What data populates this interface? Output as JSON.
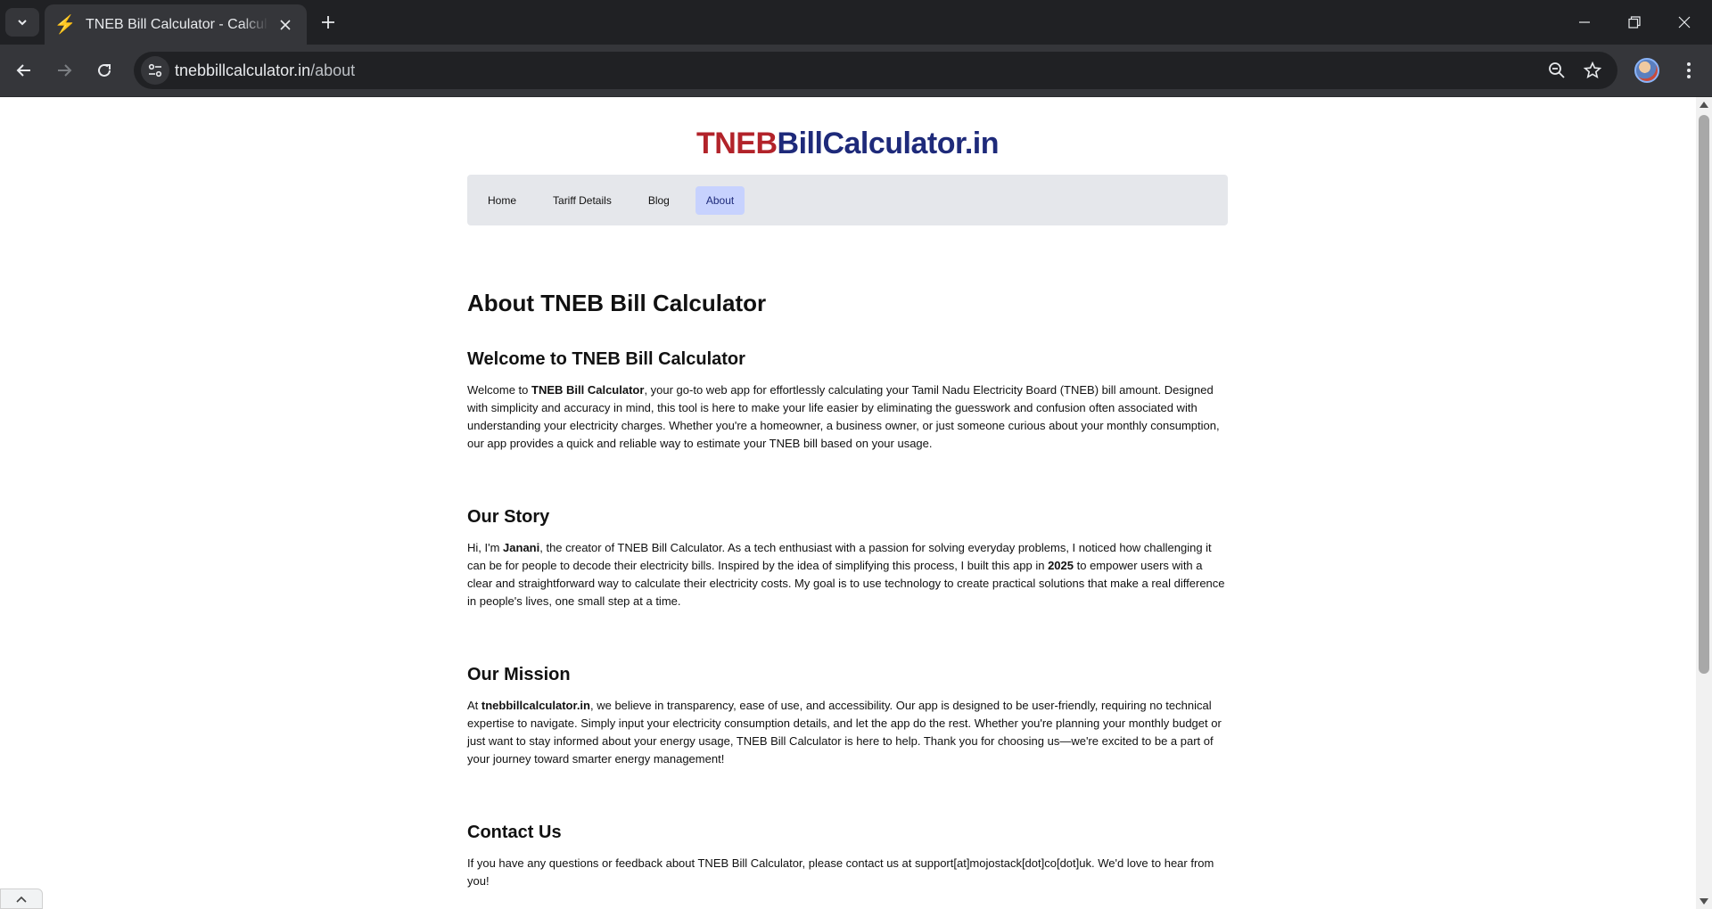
{
  "browser": {
    "tab_title": "TNEB Bill Calculator - Calculate TNEB Bill",
    "tab_favicon": "lightning-bolt-icon",
    "url_host": "tnebbillcalculator.in",
    "url_path": "/about",
    "icons": {
      "tab_search": "chevron-down-icon",
      "close_tab": "close-icon",
      "new_tab": "plus-icon",
      "minimize": "minimize-icon",
      "restore": "restore-icon",
      "close_window": "close-icon",
      "back": "back-arrow-icon",
      "forward": "forward-arrow-icon",
      "reload": "reload-icon",
      "site_info": "site-info-icon",
      "zoom": "zoom-icon",
      "bookmark": "star-icon",
      "profile": "avatar",
      "menu": "kebab-menu-icon"
    }
  },
  "site": {
    "logo_part1": "TNEB",
    "logo_part2": "BillCalculator.in",
    "logo_colors": {
      "part1": "#b2232a",
      "part2": "#1e2a7a"
    },
    "nav": [
      {
        "label": "Home"
      },
      {
        "label": "Tariff Details"
      },
      {
        "label": "Blog"
      },
      {
        "label": "About",
        "active": true
      }
    ]
  },
  "page": {
    "title": "About TNEB Bill Calculator",
    "sections": {
      "welcome": {
        "heading": "Welcome to TNEB Bill Calculator",
        "p_start": "Welcome to ",
        "p_bold": "TNEB Bill Calculator",
        "p_rest": ", your go-to web app for effortlessly calculating your Tamil Nadu Electricity Board (TNEB) bill amount. Designed with simplicity and accuracy in mind, this tool is here to make your life easier by eliminating the guesswork and confusion often associated with understanding your electricity charges. Whether you're a homeowner, a business owner, or just someone curious about your monthly consumption, our app provides a quick and reliable way to estimate your TNEB bill based on your usage."
      },
      "story": {
        "heading": "Our Story",
        "p_start": "Hi, I'm ",
        "p_bold1": "Janani",
        "p_mid": ", the creator of TNEB Bill Calculator. As a tech enthusiast with a passion for solving everyday problems, I noticed how challenging it can be for people to decode their electricity bills. Inspired by the idea of simplifying this process, I built this app in ",
        "p_bold2": "2025",
        "p_end": " to empower users with a clear and straightforward way to calculate their electricity costs. My goal is to use technology to create practical solutions that make a real difference in people's lives, one small step at a time."
      },
      "mission": {
        "heading": "Our Mission",
        "p_start": "At ",
        "p_bold": "tnebbillcalculator.in",
        "p_rest": ", we believe in transparency, ease of use, and accessibility. Our app is designed to be user-friendly, requiring no technical expertise to navigate. Simply input your electricity consumption details, and let the app do the rest. Whether you're planning your monthly budget or just want to stay informed about your energy usage, TNEB Bill Calculator is here to help. Thank you for choosing us—we're excited to be a part of your journey toward smarter energy management!"
      },
      "contact": {
        "heading": "Contact Us",
        "p": "If you have any questions or feedback about TNEB Bill Calculator, please contact us at support[at]mojostack[dot]co[dot]uk. We'd love to hear from you!"
      }
    }
  }
}
